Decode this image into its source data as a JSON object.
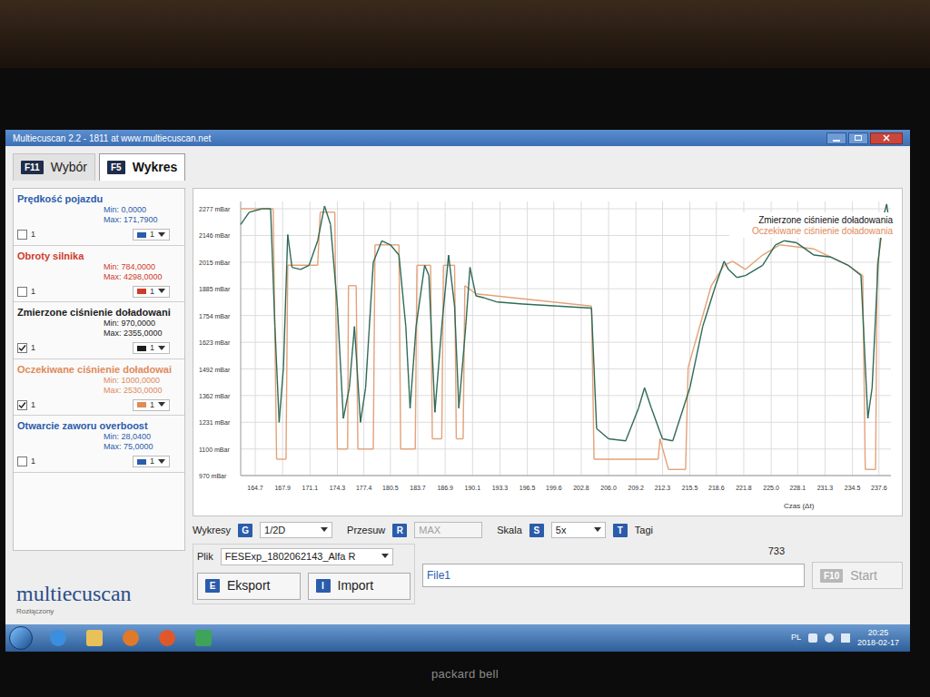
{
  "window": {
    "title": "Multiecuscan 2.2 - 1811 at www.multiecuscan.net"
  },
  "tabs": [
    {
      "key": "F11",
      "label": "Wybór",
      "selected": false
    },
    {
      "key": "F5",
      "label": "Wykres",
      "selected": true
    }
  ],
  "parameters": [
    {
      "name": "Prędkość pojazdu",
      "min": "Min: 0,0000",
      "max": "Max: 171,7900",
      "checked": false,
      "index": "1",
      "width": "1",
      "color": "#2a5cab"
    },
    {
      "name": "Obroty silnika",
      "min": "Min: 784,0000",
      "max": "Max: 4298,0000",
      "checked": false,
      "index": "1",
      "width": "1",
      "color": "#d03a2a"
    },
    {
      "name": "Zmierzone ciśnienie doładowani",
      "min": "Min: 970,0000",
      "max": "Max: 2355,0000",
      "checked": true,
      "index": "1",
      "width": "1",
      "color": "#1c1c1c"
    },
    {
      "name": "Oczekiwane ciśnienie doładowai",
      "min": "Min: 1000,0000",
      "max": "Max: 2530,0000",
      "checked": true,
      "index": "1",
      "width": "1",
      "color": "#e08a5a"
    },
    {
      "name": "Otwarcie zaworu overboost",
      "min": "Min: 28,0400",
      "max": "Max: 75,0000",
      "checked": false,
      "index": "1",
      "width": "1",
      "color": "#2a5cab"
    }
  ],
  "chart": {
    "x_min": 163,
    "x_max": 239,
    "y_min": 970,
    "y_max": 2277,
    "y_ticks": [
      "2277 mBar",
      "2146 mBar",
      "2015 mBar",
      "1885 mBar",
      "1754 mBar",
      "1623 mBar",
      "1492 mBar",
      "1362 mBar",
      "1231 mBar",
      "1100 mBar",
      "970 mBar"
    ],
    "x_ticks": [
      "164.7",
      "167.9",
      "171.1",
      "174.3",
      "177.4",
      "180.5",
      "183.7",
      "186.9",
      "190.1",
      "193.3",
      "196.5",
      "199.6",
      "202.8",
      "206.0",
      "209.2",
      "212.3",
      "215.5",
      "218.6",
      "221.8",
      "225.0",
      "228.1",
      "231.3",
      "234.5",
      "237.6"
    ],
    "x_label": "Czas (Δt)",
    "series": [
      {
        "name": "Zmierzone ciśnienie doładowania",
        "color": "#2f6b57",
        "legend_color": "#111111",
        "times": [
          163,
          164,
          165.5,
          166.5,
          167,
          167.5,
          168,
          168.5,
          169,
          170,
          171,
          172,
          172.8,
          173.5,
          174.3,
          175,
          175.7,
          176.3,
          177,
          177.6,
          178.5,
          179.5,
          180.5,
          181.5,
          182.3,
          182.8,
          183.5,
          184.5,
          185,
          185.7,
          186.5,
          187.3,
          188,
          188.5,
          189.3,
          189.8,
          190.5,
          191.5,
          193,
          196,
          200,
          204,
          204.6,
          206,
          208,
          209.5,
          210.2,
          211,
          212.3,
          213.5,
          215.5,
          217,
          218.5,
          219.5,
          220,
          221,
          222,
          224,
          225.5,
          226.5,
          228,
          230,
          232,
          234,
          235.5,
          236.3,
          236.8,
          237.5,
          238,
          238.5,
          239
        ],
        "values": [
          2200,
          2260,
          2277,
          2277,
          1700,
          1231,
          1500,
          2150,
          1990,
          1980,
          2000,
          2120,
          2290,
          2200,
          1800,
          1250,
          1400,
          1700,
          1231,
          1400,
          2015,
          2120,
          2100,
          2050,
          1700,
          1300,
          1700,
          2000,
          1950,
          1280,
          1700,
          2050,
          1800,
          1300,
          1700,
          1990,
          1850,
          1840,
          1820,
          1810,
          1800,
          1790,
          1200,
          1150,
          1140,
          1300,
          1400,
          1300,
          1150,
          1140,
          1400,
          1700,
          1900,
          2020,
          1980,
          1940,
          1950,
          2000,
          2100,
          2120,
          2110,
          2050,
          2040,
          2000,
          1950,
          1250,
          1400,
          2010,
          2220,
          2300,
          2150
        ]
      },
      {
        "name": "Oczekiwane ciśnienie doładowania",
        "color": "#e3a27a",
        "legend_color": "#e08a5a",
        "times": [
          163,
          164,
          166.8,
          167.2,
          168.3,
          168.5,
          172,
          172.3,
          174,
          174.3,
          175.5,
          175.6,
          176.5,
          176.7,
          178.5,
          178.7,
          181.5,
          181.7,
          183.4,
          183.6,
          185.2,
          185.4,
          186.5,
          186.7,
          188,
          188.2,
          189,
          189.2,
          190.5,
          204,
          204.3,
          211.8,
          212,
          213,
          215,
          215.3,
          218,
          219.5,
          220.5,
          222,
          224,
          226,
          230,
          234,
          235.7,
          236,
          237.2,
          237.4,
          238.2,
          239
        ],
        "values": [
          2277,
          2277,
          2277,
          1050,
          1050,
          2000,
          2000,
          2260,
          2260,
          1100,
          1100,
          1900,
          1900,
          1100,
          1100,
          2100,
          2100,
          1100,
          1100,
          2000,
          2000,
          1150,
          1150,
          2000,
          2000,
          1150,
          1150,
          1900,
          1860,
          1800,
          1050,
          1050,
          1150,
          1000,
          1000,
          1500,
          1900,
          2000,
          2020,
          1980,
          2050,
          2100,
          2080,
          2000,
          1950,
          1000,
          1000,
          2000,
          2230,
          2240
        ]
      }
    ]
  },
  "controls": {
    "charts": {
      "label": "Wykresy",
      "key": "G",
      "value": "1/2D"
    },
    "shift": {
      "label": "Przesuw",
      "key": "R",
      "value": "MAX",
      "disabled": true
    },
    "scale": {
      "label": "Skala",
      "key": "S",
      "value": "5x"
    },
    "tags": {
      "key": "T",
      "label": "Tagi"
    }
  },
  "file": {
    "label": "Plik",
    "value": "FESExp_1802062143_Alfa R"
  },
  "buttons": [
    {
      "key": "E",
      "label": "Eksport"
    },
    {
      "key": "I",
      "label": "Import"
    }
  ],
  "counter": "733",
  "log": "File1",
  "start": {
    "key": "F10",
    "label": "Start",
    "disabled": true
  },
  "logo": "multiecuscan",
  "status": "Rozłączony",
  "taskbar": {
    "language": "PL",
    "time": "20:25",
    "date": "2018-02-17"
  },
  "bezel": {
    "brand": "packard bell"
  }
}
